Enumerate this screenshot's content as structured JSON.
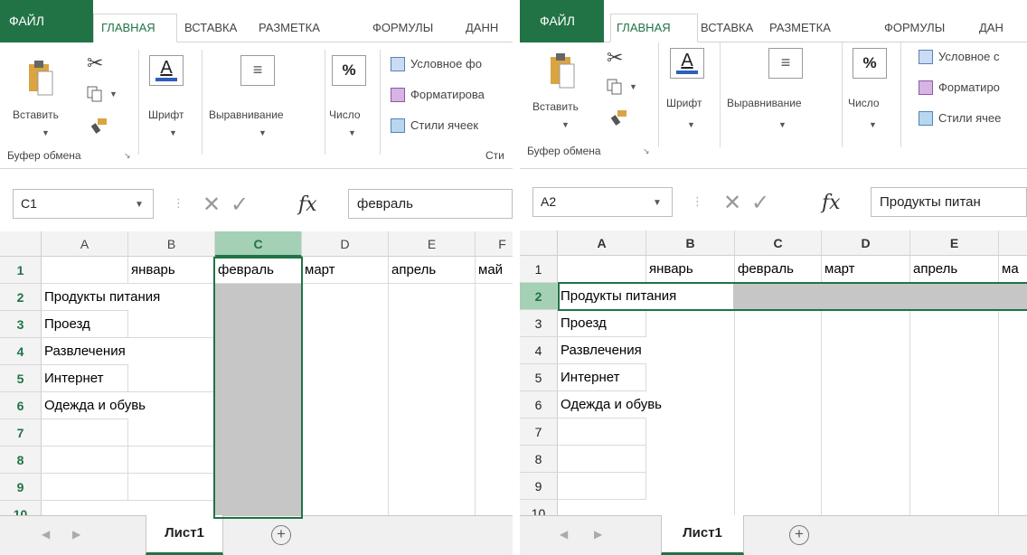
{
  "left": {
    "tabs": {
      "file": "ФАЙЛ",
      "home": "ГЛАВНАЯ",
      "insert": "ВСТАВКА",
      "layout": "РАЗМЕТКА",
      "formulas": "ФОРМУЛЫ",
      "data": "ДАНН"
    },
    "ribbon": {
      "paste": "Вставить",
      "font": "Шрифт",
      "align": "Выравнивание",
      "number": "Число",
      "cond": "Условное фо",
      "format": "Форматирова",
      "styles": "Стили ячеек",
      "styles_group": "Сти",
      "clipboard": "Буфер обмена"
    },
    "formula_bar": {
      "name_box": "C1",
      "value": "февраль"
    },
    "columns": [
      "A",
      "B",
      "C",
      "D",
      "E",
      "F"
    ],
    "rows": [
      "1",
      "2",
      "3",
      "4",
      "5",
      "6",
      "7",
      "8",
      "9",
      "10"
    ],
    "cells": {
      "b1": "январь",
      "c1": "февраль",
      "d1": "март",
      "e1": "апрель",
      "f1": "май",
      "a2": "Продукты питания",
      "a3": "Проезд",
      "a4": "Развлечения",
      "a5": "Интернет",
      "a6": "Одежда и обувь"
    },
    "sheet_tab": "Лист1"
  },
  "right": {
    "tabs": {
      "file": "ФАЙЛ",
      "home": "ГЛАВНАЯ",
      "insert": "ВСТАВКА",
      "layout": "РАЗМЕТКА",
      "formulas": "ФОРМУЛЫ",
      "data": "ДАН"
    },
    "ribbon": {
      "paste": "Вставить",
      "font": "Шрифт",
      "align": "Выравнивание",
      "number": "Число",
      "cond": "Условное с",
      "format": "Форматиро",
      "styles": "Стили ячее",
      "clipboard": "Буфер обмена"
    },
    "formula_bar": {
      "name_box": "A2",
      "value": "Продукты питан"
    },
    "columns": [
      "A",
      "B",
      "C",
      "D",
      "E"
    ],
    "rows": [
      "1",
      "2",
      "3",
      "4",
      "5",
      "6",
      "7",
      "8",
      "9",
      "10"
    ],
    "cells": {
      "b1": "январь",
      "c1": "февраль",
      "d1": "март",
      "e1": "апрель",
      "f1": "ма",
      "a2": "Продукты питания",
      "a3": "Проезд",
      "a4": "Развлечения",
      "a5": "Интернет",
      "a6": "Одежда и обувь"
    },
    "sheet_tab": "Лист1"
  },
  "icons": {
    "cut": "scissors-icon",
    "copy": "copy-icon",
    "brush": "format-painter-icon",
    "add": "plus-circle-icon"
  },
  "colors": {
    "accent": "#217346",
    "selection": "#c6c6c6",
    "header_selected": "#a4d0b5"
  }
}
